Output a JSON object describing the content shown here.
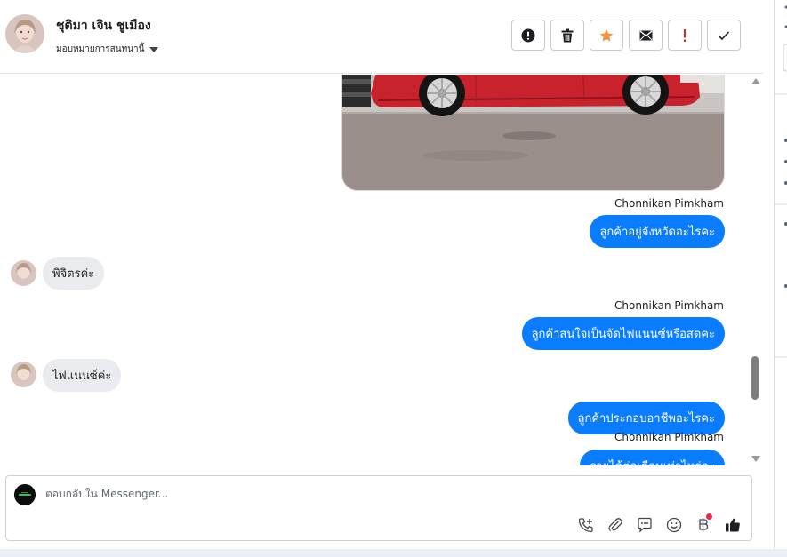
{
  "header": {
    "contact_name": "ชุติมา เจิน ชูเมือง",
    "assign_label": "มอบหมายการสนทนานี้",
    "actions": [
      {
        "name": "spam-button",
        "icon": "alert-circle-icon",
        "color": "#1c1e21"
      },
      {
        "name": "delete-button",
        "icon": "trash-icon",
        "color": "#1c1e21"
      },
      {
        "name": "follow-up-button",
        "icon": "star-icon",
        "color": "#f7923a"
      },
      {
        "name": "mark-unread-button",
        "icon": "envelope-icon",
        "color": "#1c1e21"
      },
      {
        "name": "important-button",
        "icon": "exclamation-icon",
        "color": "#e02020"
      },
      {
        "name": "done-button",
        "icon": "check-icon",
        "color": "#1c1e21"
      }
    ]
  },
  "messages": {
    "sender_1": "Chonnikan Pimkham",
    "out_1": "ลูกค้าอยู่จังหวัดอะไรคะ",
    "in_1": "พิจิตรค่ะ",
    "sender_2": "Chonnikan Pimkham",
    "out_2": "ลูกค้าสนใจเป็นจัดไฟแนนซ์หรือสดคะ",
    "in_2": "ไฟแนนซ์ค่ะ",
    "out_3": "ลูกค้าประกอบอาชีพอะไรคะ",
    "sender_3": "Chonnikan Pimkham",
    "out_4": "รายได้ต่อเดือนเท่าไหร่คะ"
  },
  "composer": {
    "placeholder": "ตอบกลับใน Messenger...",
    "tools": [
      "call-add-icon",
      "paperclip-icon",
      "saved-reply-icon",
      "emoji-icon",
      "baht-payment-icon",
      "like-icon"
    ],
    "accent": "#0a7cff"
  }
}
